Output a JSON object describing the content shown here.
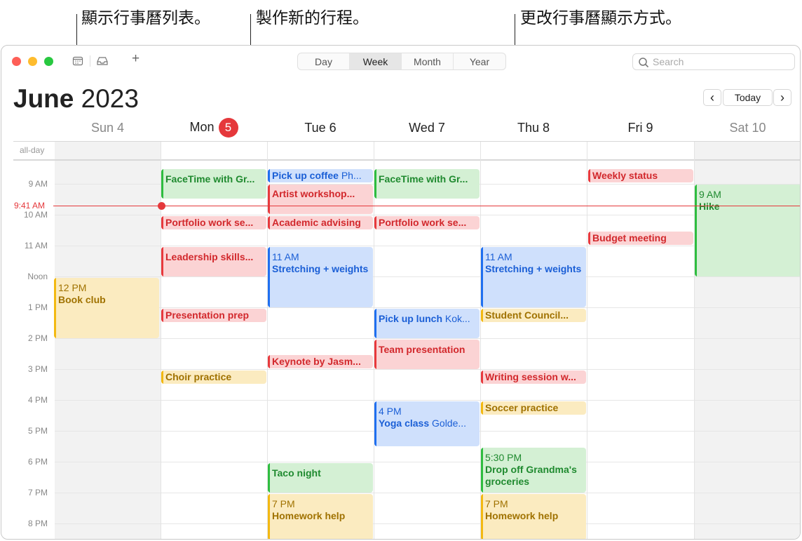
{
  "callouts": {
    "calendar_list": "顯示行事曆列表。",
    "new_event": "製作新的行程。",
    "view_mode": "更改行事曆顯示方式。"
  },
  "toolbar": {
    "add_label": "+",
    "view_tabs": [
      "Day",
      "Week",
      "Month",
      "Year"
    ],
    "selected_tab": "Week",
    "search_placeholder": "Search"
  },
  "header": {
    "month": "June",
    "year": "2023",
    "prev": "‹",
    "today": "Today",
    "next": "›"
  },
  "days": [
    {
      "label": "Sun 4"
    },
    {
      "label": "Mon",
      "badge": "5"
    },
    {
      "label": "Tue 6"
    },
    {
      "label": "Wed 7"
    },
    {
      "label": "Thu 8"
    },
    {
      "label": "Fri 9"
    },
    {
      "label": "Sat 10"
    }
  ],
  "allday_label": "all-day",
  "time_labels": [
    "9 AM",
    "10 AM",
    "11 AM",
    "Noon",
    "1 PM",
    "2 PM",
    "3 PM",
    "4 PM",
    "5 PM",
    "6 PM",
    "7 PM",
    "8 PM"
  ],
  "current_time": "9:41 AM",
  "colors": {
    "accent_red": "#e5383b",
    "event_green": "#2ebd3f",
    "event_red": "#e8393d",
    "event_blue": "#1f6ff0",
    "event_yellow": "#f3b911"
  },
  "events": {
    "sun_book_club": {
      "time": "12 PM",
      "title": "Book club"
    },
    "mon_facetime": {
      "title": "FaceTime with Gr..."
    },
    "mon_portfolio": {
      "title": "Portfolio work se..."
    },
    "mon_leadership": {
      "title": "Leadership skills..."
    },
    "mon_presentation": {
      "title": "Presentation prep"
    },
    "mon_choir": {
      "title": "Choir practice"
    },
    "tue_coffee": {
      "title": "Pick up coffee",
      "location": "Ph..."
    },
    "tue_artist": {
      "title": "Artist workshop..."
    },
    "tue_academic": {
      "title": "Academic advising"
    },
    "tue_stretching": {
      "time": "11 AM",
      "title": "Stretching + weights"
    },
    "tue_keynote": {
      "title": "Keynote by Jasm..."
    },
    "tue_taco": {
      "title": "Taco night"
    },
    "tue_homework": {
      "time": "7 PM",
      "title": "Homework help"
    },
    "wed_facetime": {
      "title": "FaceTime with Gr..."
    },
    "wed_portfolio": {
      "title": "Portfolio work se..."
    },
    "wed_lunch": {
      "title": "Pick up lunch",
      "location": "Kok..."
    },
    "wed_team": {
      "title": "Team presentation"
    },
    "wed_yoga": {
      "time": "4 PM",
      "title": "Yoga class",
      "location": "Golde..."
    },
    "thu_stretching": {
      "time": "11 AM",
      "title": "Stretching + weights"
    },
    "thu_council": {
      "title": "Student Council..."
    },
    "thu_writing": {
      "title": "Writing session w..."
    },
    "thu_soccer": {
      "title": "Soccer practice"
    },
    "thu_dropoff": {
      "time": "5:30 PM",
      "title": "Drop off Grandma's groceries"
    },
    "thu_homework": {
      "time": "7 PM",
      "title": "Homework help"
    },
    "fri_weekly": {
      "title": "Weekly status"
    },
    "fri_budget": {
      "title": "Budget meeting"
    },
    "sat_hike": {
      "time": "9 AM",
      "title": "Hike"
    }
  }
}
